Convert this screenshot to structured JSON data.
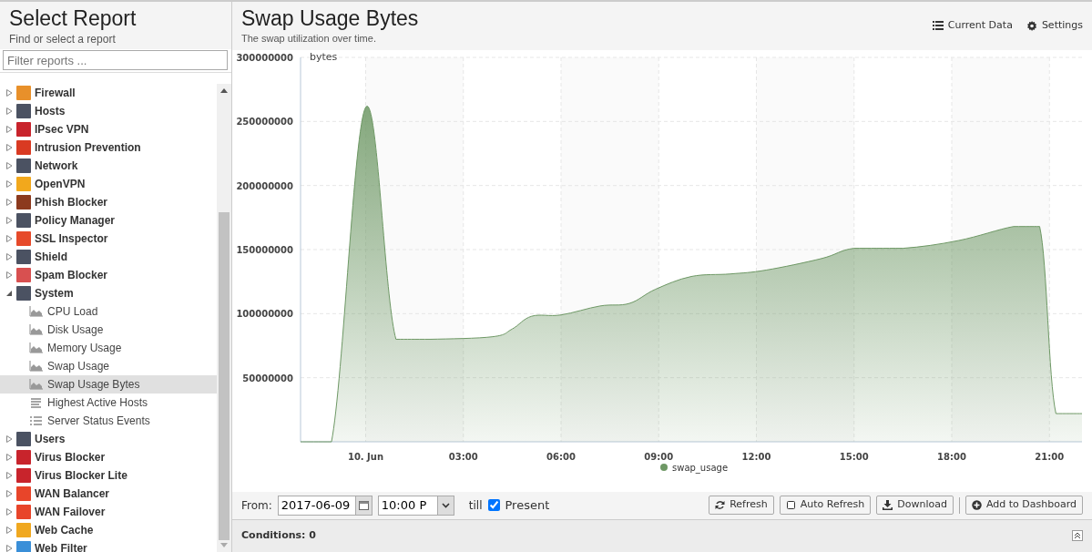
{
  "sidebar": {
    "title": "Select Report",
    "subtitle": "Find or select a report",
    "filter": {
      "placeholder": "Filter reports ..."
    },
    "items": [
      {
        "label": "Firewall",
        "color": "#e8902a",
        "expanded": false
      },
      {
        "label": "Hosts",
        "color": "#4b5262",
        "expanded": false
      },
      {
        "label": "IPsec VPN",
        "color": "#c8242c",
        "expanded": false
      },
      {
        "label": "Intrusion Prevention",
        "color": "#d93a22",
        "expanded": false
      },
      {
        "label": "Network",
        "color": "#4b5262",
        "expanded": false
      },
      {
        "label": "OpenVPN",
        "color": "#f2a81c",
        "expanded": false
      },
      {
        "label": "Phish Blocker",
        "color": "#8c3a1e",
        "expanded": false
      },
      {
        "label": "Policy Manager",
        "color": "#4b5262",
        "expanded": false
      },
      {
        "label": "SSL Inspector",
        "color": "#e64a2a",
        "expanded": false
      },
      {
        "label": "Shield",
        "color": "#4b5262",
        "expanded": false
      },
      {
        "label": "Spam Blocker",
        "color": "#d85050",
        "expanded": false
      },
      {
        "label": "System",
        "color": "#4b5262",
        "expanded": true,
        "children": [
          {
            "label": "CPU Load",
            "kind": "chart",
            "selected": false
          },
          {
            "label": "Disk Usage",
            "kind": "chart",
            "selected": false
          },
          {
            "label": "Memory Usage",
            "kind": "chart",
            "selected": false
          },
          {
            "label": "Swap Usage",
            "kind": "chart",
            "selected": false
          },
          {
            "label": "Swap Usage Bytes",
            "kind": "chart",
            "selected": true
          },
          {
            "label": "Highest Active Hosts",
            "kind": "text",
            "selected": false
          },
          {
            "label": "Server Status Events",
            "kind": "events",
            "selected": false
          }
        ]
      },
      {
        "label": "Users",
        "color": "#4b5262",
        "expanded": false
      },
      {
        "label": "Virus Blocker",
        "color": "#c8242c",
        "expanded": false
      },
      {
        "label": "Virus Blocker Lite",
        "color": "#c8242c",
        "expanded": false
      },
      {
        "label": "WAN Balancer",
        "color": "#e8452a",
        "expanded": false
      },
      {
        "label": "WAN Failover",
        "color": "#e8452a",
        "expanded": false
      },
      {
        "label": "Web Cache",
        "color": "#f0a820",
        "expanded": false
      },
      {
        "label": "Web Filter",
        "color": "#3a8fd8",
        "expanded": false
      }
    ]
  },
  "report": {
    "title": "Swap Usage Bytes",
    "subtitle": "The swap utilization over time.",
    "actions": [
      "Current Data",
      "Settings"
    ],
    "chart_data": {
      "type": "area",
      "grid": true,
      "ylabel": "bytes",
      "x": [
        -2,
        -1.05,
        0,
        0.93,
        2,
        3.9,
        4.5,
        5.1,
        6,
        7.2,
        8.1,
        8.9,
        10,
        11.2,
        12.3,
        14,
        15,
        16.5,
        18.2,
        19.9,
        20.7,
        21.2,
        22
      ],
      "series": [
        {
          "name": "swap_usage",
          "color": "#6e9865",
          "values": [
            0,
            0,
            261000000,
            80000000,
            80000000,
            82000000,
            88000000,
            98000000,
            99000000,
            106000000,
            108000000,
            119000000,
            129000000,
            131000000,
            134000000,
            143000000,
            151000000,
            151000000,
            157000000,
            168000000,
            168000000,
            22000000,
            22000000
          ]
        }
      ],
      "xlim": [
        -2,
        22
      ],
      "ylim": [
        0,
        300000000
      ],
      "xticks": [
        {
          "value": 0,
          "label": "10. Jun"
        },
        {
          "value": 3,
          "label": "03:00"
        },
        {
          "value": 6,
          "label": "06:00"
        },
        {
          "value": 9,
          "label": "09:00"
        },
        {
          "value": 12,
          "label": "12:00"
        },
        {
          "value": 15,
          "label": "15:00"
        },
        {
          "value": 18,
          "label": "18:00"
        },
        {
          "value": 21,
          "label": "21:00"
        }
      ],
      "yticks": [
        {
          "value": 50000000,
          "label": "50000000"
        },
        {
          "value": 100000000,
          "label": "100000000"
        },
        {
          "value": 150000000,
          "label": "150000000"
        },
        {
          "value": 200000000,
          "label": "200000000"
        },
        {
          "value": 250000000,
          "label": "250000000"
        },
        {
          "value": 300000000,
          "label": "300000000"
        }
      ]
    },
    "toolbar": {
      "from_label": "From:",
      "date": "2017-06-09",
      "time": "10:00 P",
      "till_label": "till",
      "present": {
        "label": "Present",
        "checked": true
      },
      "buttons": [
        {
          "label": "Refresh",
          "kind": "refresh"
        },
        {
          "label": "Auto Refresh",
          "kind": "toggle"
        },
        {
          "label": "Download",
          "kind": "download"
        },
        {
          "label": "Add to Dashboard",
          "kind": "add"
        }
      ]
    },
    "conditions": "Conditions: 0"
  }
}
